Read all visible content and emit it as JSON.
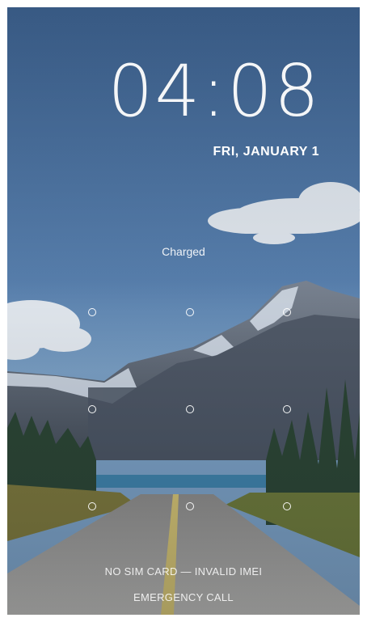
{
  "lockscreen": {
    "time": "04:08",
    "date": "FRI, JANUARY 1",
    "charge_status": "Charged",
    "sim_status": "NO SIM CARD — INVALID IMEI",
    "emergency_label": "EMERGENCY CALL"
  },
  "wallpaper": {
    "subject": "mountain road landscape",
    "colors": {
      "sky_top": "#3f6490",
      "sky_bottom": "#6f95bf",
      "mountain": "#5b6676",
      "snow": "#d9e1ea",
      "forest": "#2f4a32",
      "lake": "#3d7fa8",
      "road": "#a9a6a2"
    }
  },
  "pattern_lock": {
    "rows": 3,
    "cols": 3,
    "dot_color": "#ffffff"
  }
}
